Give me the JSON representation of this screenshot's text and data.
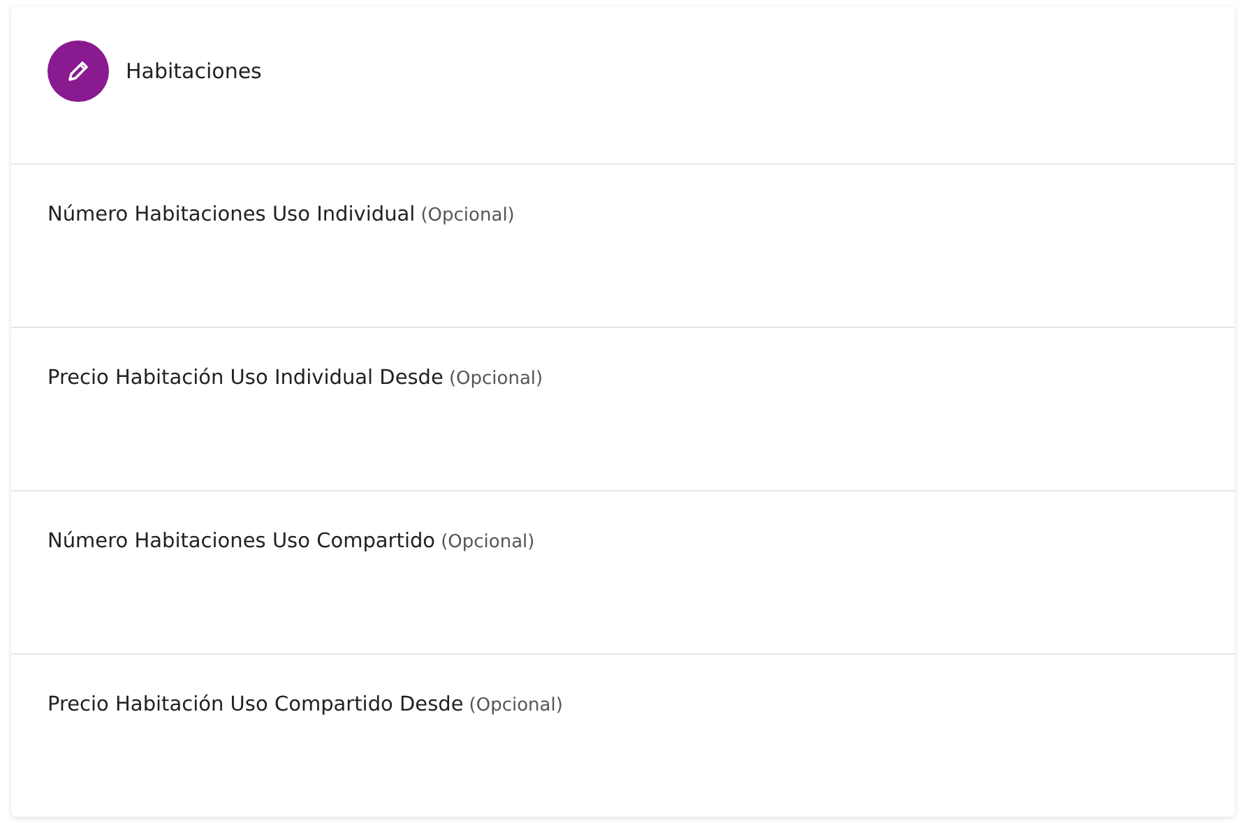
{
  "section": {
    "title": "Habitaciones"
  },
  "fields": [
    {
      "label": "Número Habitaciones Uso Individual",
      "hint": "(Opcional)"
    },
    {
      "label": "Precio Habitación Uso Individual Desde",
      "hint": "(Opcional)"
    },
    {
      "label": "Número Habitaciones Uso Compartido",
      "hint": "(Opcional)"
    },
    {
      "label": "Precio Habitación Uso Compartido Desde",
      "hint": "(Opcional)"
    }
  ]
}
